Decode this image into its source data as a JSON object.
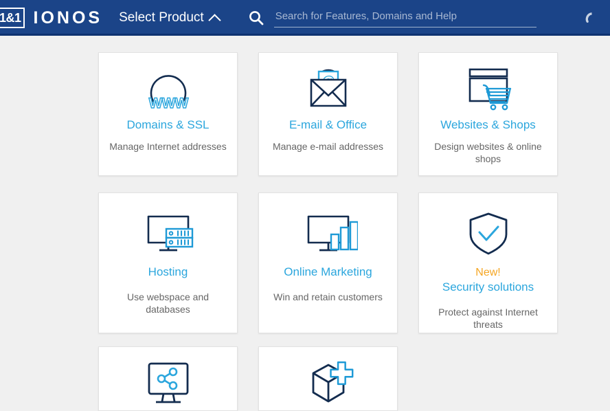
{
  "header": {
    "logo_box": "1&1",
    "logo_word": "IONOS",
    "select_product": "Select Product",
    "chevron_icon": "chevron-up-icon",
    "search_icon": "search-icon",
    "search_value": "",
    "search_placeholder": "Search for Features, Domains and Help",
    "phone_icon": "phone-icon",
    "bg_color": "#1b4488"
  },
  "colors": {
    "page_bg": "#f0f0f0",
    "card_bg": "#ffffff",
    "accent_cyan": "#2ba6dd",
    "icon_navy": "#0d2240",
    "badge_orange": "#f5a623",
    "desc_gray": "#666666"
  },
  "cards": [
    {
      "title": "Domains & SSL",
      "desc": "Manage Internet addresses",
      "icon": "globe-www-icon",
      "badge": ""
    },
    {
      "title": "E-mail & Office",
      "desc": "Manage e-mail addresses",
      "icon": "envelope-at-icon",
      "badge": ""
    },
    {
      "title": "Websites & Shops",
      "desc": "Design websites & online shops",
      "icon": "browser-cart-icon",
      "badge": ""
    },
    {
      "title": "Hosting",
      "desc": "Use webspace and databases",
      "icon": "monitor-server-icon",
      "badge": ""
    },
    {
      "title": "Online Marketing",
      "desc": "Win and retain customers",
      "icon": "monitor-barchart-icon",
      "badge": ""
    },
    {
      "title": "Security solutions",
      "desc": "Protect against Internet threats",
      "icon": "shield-check-icon",
      "badge": "New!"
    },
    {
      "title": "",
      "desc": "",
      "icon": "monitor-share-icon",
      "badge": ""
    },
    {
      "title": "",
      "desc": "",
      "icon": "box-plus-icon",
      "badge": ""
    }
  ]
}
